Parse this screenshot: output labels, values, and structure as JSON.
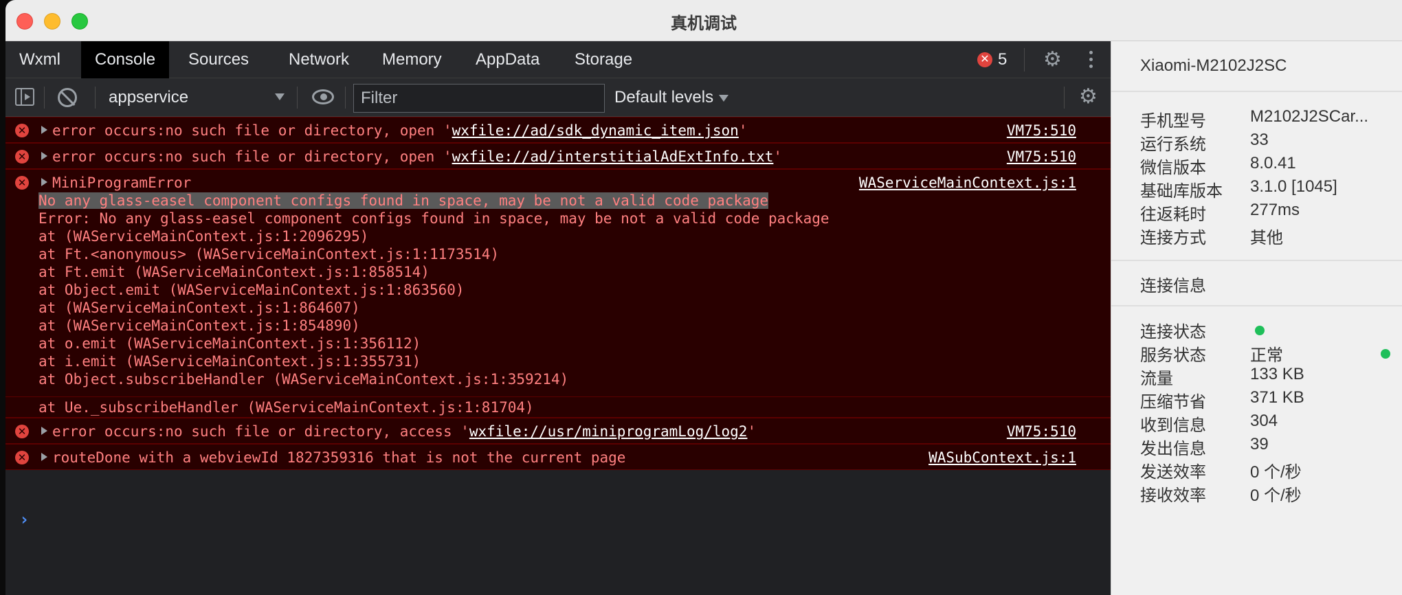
{
  "window": {
    "title": "真机调试"
  },
  "tabs": [
    {
      "label": "Wxml"
    },
    {
      "label": "Console"
    },
    {
      "label": "Sources"
    },
    {
      "label": "Network"
    },
    {
      "label": "Memory"
    },
    {
      "label": "AppData"
    },
    {
      "label": "Storage"
    }
  ],
  "error_badge": {
    "count": "5"
  },
  "toolbar": {
    "context": "appservice",
    "filter_placeholder": "Filter",
    "levels": "Default levels"
  },
  "console": {
    "messages": [
      {
        "prefix": "error occurs:no such file or directory, open '",
        "link": "wxfile://ad/sdk_dynamic_item.json",
        "suffix": "'",
        "source": "VM75:510"
      },
      {
        "prefix": "error occurs:no such file or directory, open '",
        "link": "wxfile://ad/interstitialAdExtInfo.txt",
        "suffix": "'",
        "source": "VM75:510"
      },
      {
        "prefix": "MiniProgramError",
        "link": "",
        "suffix": "",
        "source": "WAServiceMainContext.js:1"
      },
      {
        "prefix": "error occurs:no such file or directory, access '",
        "link": "wxfile://usr/miniprogramLog/log2",
        "suffix": "'",
        "source": "VM75:510"
      },
      {
        "prefix": "routeDone with a webviewId 1827359316 that is not the current page",
        "link": "",
        "suffix": "",
        "source": "WASubContext.js:1"
      }
    ],
    "stack": {
      "highlighted": "No any glass-easel component configs found in space, may be not a valid code package",
      "lines": [
        "Error: No any glass-easel component configs found in space, may be not a valid code package",
        "at (WAServiceMainContext.js:1:2096295)",
        "at Ft.<anonymous> (WAServiceMainContext.js:1:1173514)",
        "at Ft.emit (WAServiceMainContext.js:1:858514)",
        "at Object.emit (WAServiceMainContext.js:1:863560)",
        "at (WAServiceMainContext.js:1:864607)",
        "at (WAServiceMainContext.js:1:854890)",
        "at o.emit (WAServiceMainContext.js:1:356112)",
        "at i.emit (WAServiceMainContext.js:1:355731)",
        "at Object.subscribeHandler (WAServiceMainContext.js:1:359214)",
        "at Ue._subscribeHandler (WAServiceMainContext.js:1:81704)"
      ]
    }
  },
  "device": {
    "name": "Xiaomi-M2102J2SC",
    "info": [
      {
        "key": "手机型号",
        "value": "M2102J2SCar..."
      },
      {
        "key": "运行系统",
        "value": "33"
      },
      {
        "key": "微信版本",
        "value": "8.0.41"
      },
      {
        "key": "基础库版本",
        "value": "3.1.0 [1045]"
      },
      {
        "key": "往返耗时",
        "value": "277ms"
      },
      {
        "key": "连接方式",
        "value": "其他"
      }
    ],
    "connection_title": "连接信息",
    "connection": [
      {
        "key": "连接状态",
        "value": ""
      },
      {
        "key": "服务状态",
        "value": "正常"
      },
      {
        "key": "流量",
        "value": "133 KB"
      },
      {
        "key": "压缩节省",
        "value": "371 KB"
      },
      {
        "key": "收到信息",
        "value": "304"
      },
      {
        "key": "发出信息",
        "value": "39"
      },
      {
        "key": "发送效率",
        "value": "0 个/秒"
      },
      {
        "key": "接收效率",
        "value": "0 个/秒"
      }
    ]
  },
  "colors": {
    "error_bg": "#290000",
    "error_text": "#ff8080",
    "status_green": "#1fbf5a"
  }
}
